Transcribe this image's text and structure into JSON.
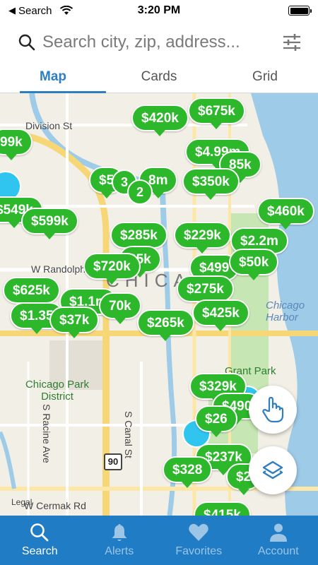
{
  "status_bar": {
    "back_app": "Search",
    "time": "3:20 PM"
  },
  "search": {
    "placeholder": "Search city, zip, address..."
  },
  "tabs": [
    {
      "label": "Map",
      "active": true
    },
    {
      "label": "Cards",
      "active": false
    },
    {
      "label": "Grid",
      "active": false
    }
  ],
  "map": {
    "streets": [
      "Division St",
      "W Randolph",
      "W Cermak Rd",
      "S Canal St",
      "S Racine Ave",
      "Grant Park",
      "Chicago Park District",
      "Chicago Harbor",
      "Legal"
    ],
    "highway_shield": "90",
    "neighborhood_partial": "CHICAGO"
  },
  "pins": [
    "$420k",
    "$675k",
    "$4.99m",
    "$5",
    "3",
    "8m",
    "$599k",
    "$549k",
    "99k",
    "$350k",
    "$285k",
    "$229k",
    "$2.2m",
    "$460k",
    "$720k",
    "35k",
    "$499",
    "$50k",
    "$625k",
    "$1.1m",
    "70k",
    "$1.35",
    "$37k",
    "$275k",
    "$425k",
    "$265k",
    "$329k",
    "$490",
    "$26",
    "$237k",
    "$328",
    "$2",
    "$415k",
    "85k",
    "$2"
  ],
  "clusters": [
    "2"
  ],
  "bottom_nav": [
    {
      "label": "Search",
      "icon": "search-icon",
      "active": true
    },
    {
      "label": "Alerts",
      "icon": "bell-icon",
      "active": false
    },
    {
      "label": "Favorites",
      "icon": "heart-icon",
      "active": false
    },
    {
      "label": "Account",
      "icon": "person-icon",
      "active": false
    }
  ],
  "colors": {
    "accent": "#2e7fc1",
    "pin_green": "#2db82b",
    "nav_blue": "#1f7cc5",
    "water": "#9ecbe8"
  }
}
